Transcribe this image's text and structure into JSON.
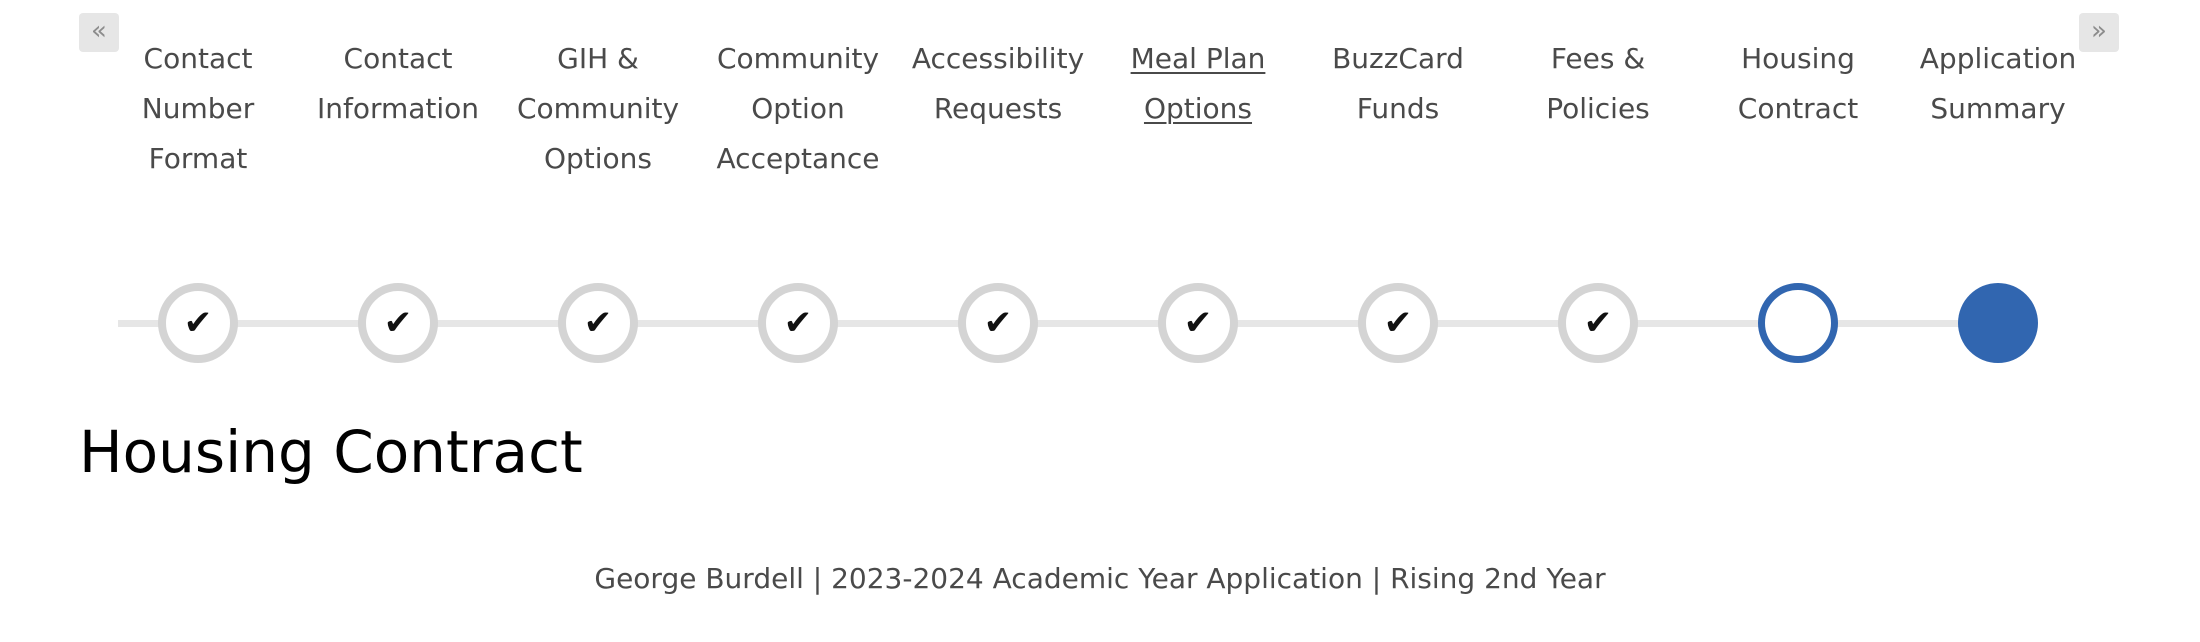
{
  "nav": {
    "prev_icon": "«",
    "prev_icon_name": "double-chevron-left-icon",
    "next_icon": "»",
    "next_icon_name": "double-chevron-right-icon"
  },
  "steps": [
    {
      "label": "Contact Number Format",
      "state": "complete"
    },
    {
      "label": "Contact Information",
      "state": "complete"
    },
    {
      "label": "GIH & Community Options",
      "state": "complete"
    },
    {
      "label": "Community Option Acceptance",
      "state": "complete"
    },
    {
      "label": "Accessibility Requests",
      "state": "complete"
    },
    {
      "label": "Meal Plan Options",
      "state": "complete",
      "link": true
    },
    {
      "label": "BuzzCard Funds",
      "state": "complete"
    },
    {
      "label": "Fees & Policies",
      "state": "complete"
    },
    {
      "label": "Housing Contract",
      "state": "current"
    },
    {
      "label": "Application Summary",
      "state": "pending"
    }
  ],
  "check_icon": "✔",
  "page_title": "Housing Contract",
  "footer": {
    "info": "George Burdell | 2023-2024 Academic Year Application | Rising 2nd Year"
  },
  "colors": {
    "accent": "#3166b0",
    "complete_ring": "#d4d4d4",
    "track": "#e6e6e6",
    "text": "#4a4a4a"
  }
}
